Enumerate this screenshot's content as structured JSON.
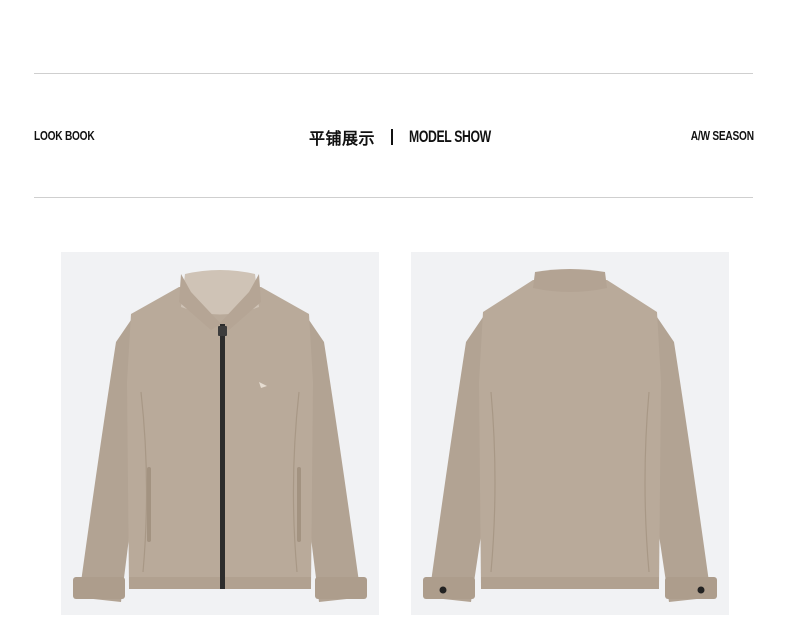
{
  "header": {
    "left_label": "LOOK BOOK",
    "center_cn": "平铺展示",
    "center_en": "MODEL SHOW",
    "right_label": "A/W SEASON"
  },
  "colors": {
    "jacket": "#b9aa9a",
    "jacket_shadow": "#a89886",
    "photo_bg": "#f1f2f4",
    "zipper": "#2c2c2c",
    "rule": "#cfcfcf"
  },
  "images": [
    {
      "name": "jacket-front-photo",
      "icon": "jacket-front"
    },
    {
      "name": "jacket-back-photo",
      "icon": "jacket-back"
    }
  ]
}
